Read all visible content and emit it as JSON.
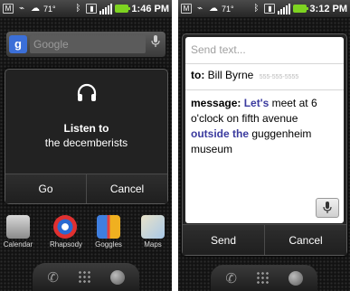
{
  "left": {
    "status": {
      "temperature": "71°",
      "time": "1:46 PM"
    },
    "search": {
      "logo": "g",
      "placeholder": "Google"
    },
    "dialog": {
      "title": "Listen to",
      "subtitle": "the decemberists",
      "buttons": {
        "primary": "Go",
        "secondary": "Cancel"
      }
    },
    "apps": [
      "Calendar",
      "Rhapsody",
      "Goggles",
      "Maps"
    ]
  },
  "right": {
    "status": {
      "temperature": "71°",
      "time": "3:12 PM"
    },
    "dialog": {
      "placeholder": "Send text...",
      "to_label": "to:",
      "to_name": "Bill Byrne",
      "to_number": "555-555-5555",
      "message_label": "message:",
      "message_parts": {
        "p1": "Let's",
        "p2": " meet at 6 o'clock on fifth avenue ",
        "p3": "outside the",
        "p4": " guggenheim museum"
      },
      "buttons": {
        "primary": "Send",
        "secondary": "Cancel"
      }
    }
  },
  "colors": {
    "battery": "#7ed321",
    "highlight_word": "#3a3a9e",
    "dialog_bg": "#222222"
  },
  "icons": [
    "gmail-icon",
    "usb-icon",
    "weather-icon",
    "bluetooth-icon",
    "vibrate-icon",
    "signal-icon",
    "battery-icon",
    "headphones-icon",
    "microphone-icon",
    "phone-icon",
    "app-drawer-icon",
    "browser-icon"
  ]
}
